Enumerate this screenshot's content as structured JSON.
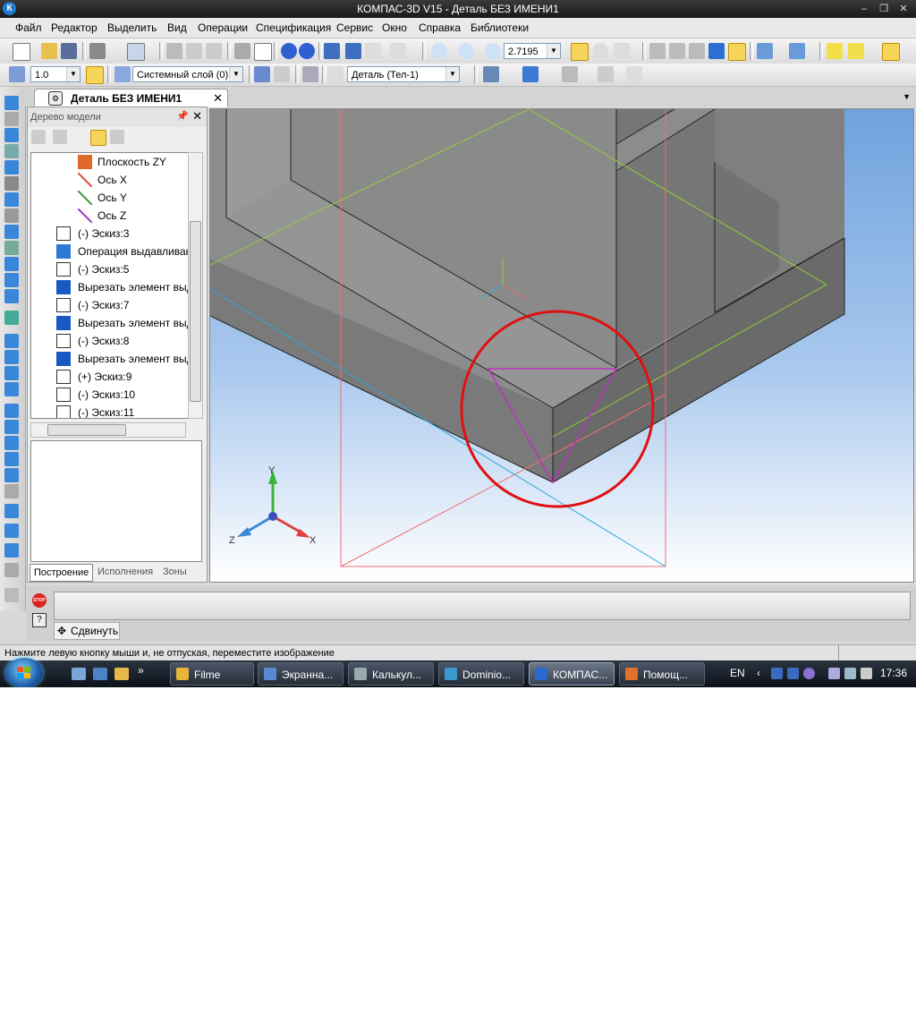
{
  "window": {
    "title": "КОМПАС-3D V15 - Деталь БЕЗ ИМЕНИ1",
    "app_icon": "К"
  },
  "menu": [
    "Файл",
    "Редактор",
    "Выделить",
    "Вид",
    "Операции",
    "Спецификация",
    "Сервис",
    "Окно",
    "Справка",
    "Библиотеки"
  ],
  "toolbar": {
    "zoom_value": "2.7195",
    "step_value": "1.0",
    "layer": "Системный слой (0)",
    "part": "Деталь (Тел-1)"
  },
  "document_tab": {
    "label": "Деталь БЕЗ ИМЕНИ1"
  },
  "tree_panel": {
    "title": "Дерево модели",
    "items": [
      {
        "label": "Плоскость ZY",
        "icon": "plane-icon",
        "indent": 2
      },
      {
        "label": "Ось X",
        "icon": "axis-x-icon",
        "indent": 2
      },
      {
        "label": "Ось Y",
        "icon": "axis-y-icon",
        "indent": 2
      },
      {
        "label": "Ось Z",
        "icon": "axis-z-icon",
        "indent": 2
      },
      {
        "label": "(-) Эскиз:3",
        "icon": "sketch-icon",
        "indent": 1
      },
      {
        "label": "Операция выдавливания",
        "icon": "extrude-icon",
        "indent": 1
      },
      {
        "label": "(-) Эскиз:5",
        "icon": "sketch-icon",
        "indent": 1
      },
      {
        "label": "Вырезать элемент выдавливания",
        "icon": "cut-icon",
        "indent": 1
      },
      {
        "label": "(-) Эскиз:7",
        "icon": "sketch-icon",
        "indent": 1
      },
      {
        "label": "Вырезать элемент выдавливания",
        "icon": "cut-icon",
        "indent": 1
      },
      {
        "label": "(-) Эскиз:8",
        "icon": "sketch-icon",
        "indent": 1
      },
      {
        "label": "Вырезать элемент выдавливания",
        "icon": "cut-icon",
        "indent": 1
      },
      {
        "label": "(+) Эскиз:9",
        "icon": "sketch-icon",
        "indent": 1
      },
      {
        "label": "(-) Эскиз:10",
        "icon": "sketch-icon",
        "indent": 1
      },
      {
        "label": "(-) Эскиз:11",
        "icon": "sketch-icon",
        "indent": 1
      }
    ],
    "tabs": [
      "Построение",
      "Исполнения",
      "Зоны"
    ]
  },
  "viewport": {
    "axis_labels": {
      "x": "X",
      "y": "Y",
      "z": "Z"
    }
  },
  "command": {
    "stop_label": "STOP",
    "help_label": "?",
    "move_label": "Сдвинуть"
  },
  "status": {
    "text": "Нажмите левую кнопку мыши и, не отпуская, переместите изображение"
  },
  "taskbar": {
    "buttons": [
      {
        "label": "Filme",
        "icon": "folder-icon"
      },
      {
        "label": "Экранна...",
        "icon": "screen-icon"
      },
      {
        "label": "Калькул...",
        "icon": "calculator-icon"
      },
      {
        "label": "Dominio...",
        "icon": "drive-icon"
      },
      {
        "label": "КОМПАС...",
        "icon": "kompas-icon"
      },
      {
        "label": "Помощ...",
        "icon": "firefox-icon"
      }
    ],
    "lang": "EN",
    "time": "17:36"
  }
}
